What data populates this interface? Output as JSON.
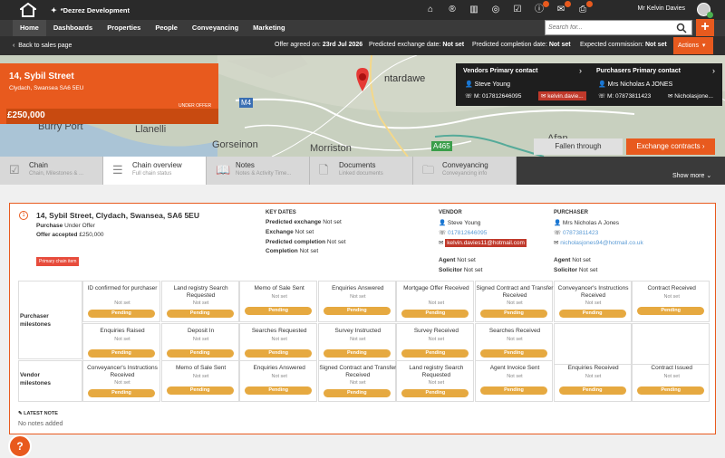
{
  "app": {
    "brand": "*Dezrez Development",
    "user": "Mr Kelvin Davies"
  },
  "nav": {
    "items": [
      "Home",
      "Dashboards",
      "Properties",
      "People",
      "Conveyancing",
      "Marketing"
    ]
  },
  "search": {
    "placeholder": "Search for..."
  },
  "subbar": {
    "back": "Back to sales page",
    "offer_label": "Offer agreed on:",
    "offer_value": "23rd Jul 2026",
    "exchange_label": "Predicted exchange date:",
    "exchange_value": "Not set",
    "completion_label": "Predicted completion date:",
    "completion_value": "Not set",
    "commission_label": "Expected commission:",
    "commission_value": "Not set",
    "actions": "Actions"
  },
  "property": {
    "title": "14, Sybil Street",
    "address": "Clydach, Swansea SA6 5EU",
    "price": "£250,000",
    "status": "UNDER OFFER"
  },
  "map_labels": {
    "burry": "Burry Port",
    "llanelli": "Llanelli",
    "gorseinon": "Gorseinon",
    "morriston": "Morriston",
    "ntardawe": "ntardawe",
    "m4": "M4",
    "a465": "A465",
    "afan": "Afan"
  },
  "vendors_contact": {
    "title": "Vendors Primary contact",
    "name": "Steve Young",
    "mobile": "M: 017812646095",
    "email": "kelvin.davie..."
  },
  "purchasers_contact": {
    "title": "Purchasers Primary contact",
    "name": "Mrs Nicholas A JONES",
    "mobile": "M: 07873811423",
    "email": "Nicholasjone..."
  },
  "buttons": {
    "fell": "Fallen through",
    "exchange": "Exchange contracts",
    "show_more": "Show more"
  },
  "tabs": [
    {
      "label": "Chain",
      "sub": "Chain, Milestones & ..."
    },
    {
      "label": "Chain overview",
      "sub": "Full chain status"
    },
    {
      "label": "Notes",
      "sub": "Notes & Activity Time..."
    },
    {
      "label": "Documents",
      "sub": "Linked documents"
    },
    {
      "label": "Conveyancing",
      "sub": "Conveyancing info"
    }
  ],
  "chain": {
    "number": "1",
    "title": "14, Sybil Street, Clydach, Swansea, SA6 5EU",
    "purchase_label": "Purchase",
    "purchase_value": "Under Offer",
    "offer_label": "Offer accepted",
    "offer_value": "£250,000",
    "badge": "Primary chain item"
  },
  "key_dates": {
    "title": "KEY DATES",
    "items": [
      {
        "label": "Predicted exchange",
        "value": "Not set"
      },
      {
        "label": "Exchange",
        "value": "Not set"
      },
      {
        "label": "Predicted completion",
        "value": "Not set"
      },
      {
        "label": "Completion",
        "value": "Not set"
      }
    ]
  },
  "vendor": {
    "title": "VENDOR",
    "name": "Steve Young",
    "phone": "017812646095",
    "email": "kelvin.davies11@hotmail.com",
    "agent_label": "Agent",
    "agent": "Not set",
    "solicitor_label": "Solicitor",
    "solicitor": "Not set"
  },
  "purchaser": {
    "title": "PURCHASER",
    "name": "Mrs Nicholas A Jones",
    "phone": "07873811423",
    "email": "nicholasjones94@hotmail.co.uk",
    "agent_label": "Agent",
    "agent": "Not set",
    "solicitor_label": "Solicitor",
    "solicitor": "Not set"
  },
  "milestones": {
    "purchaser_label": "Purchaser milestones",
    "vendor_label": "Vendor milestones",
    "not_set": "Not set",
    "pending": "Pending",
    "purchaser_row1": [
      "ID confirmed for purchaser",
      "Land registry Search Requested",
      "Memo of Sale Sent",
      "Enquiries Answered",
      "Mortgage Offer Received",
      "Signed Contract and Transfer Received",
      "Conveyancer's Instructions Received",
      "Contract Received"
    ],
    "purchaser_row2": [
      "Enquiries Raised",
      "Deposit In",
      "Searches Requested",
      "Survey Instructed",
      "Survey Received",
      "Searches Received"
    ],
    "vendor_row": [
      "Conveyancer's Instructions Received",
      "Memo of Sale Sent",
      "Enquiries Answered",
      "Signed Contract and Transfer Received",
      "Land registry Search Requested",
      "Agent Invoice Sent",
      "Enquiries Received",
      "Contract Issued"
    ]
  },
  "notes": {
    "title": "LATEST NOTE",
    "empty": "No notes added"
  },
  "help": "?"
}
